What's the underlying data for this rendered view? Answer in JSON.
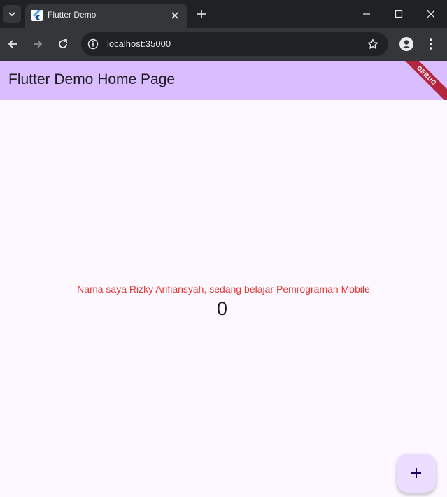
{
  "browser": {
    "tab": {
      "title": "Flutter Demo"
    },
    "omnibox": {
      "url": "localhost:35000"
    }
  },
  "app": {
    "title": "Flutter Demo Home Page",
    "debug_banner": "DEBUG",
    "message": "Nama saya Rizky Arifiansyah, sedang belajar Pemrograman Mobile",
    "counter": "0",
    "fab_label": "+"
  },
  "colors": {
    "appbar": "#d9bdff",
    "background": "#fdf7ff",
    "message": "#e53935",
    "fab": "#eaddff"
  }
}
